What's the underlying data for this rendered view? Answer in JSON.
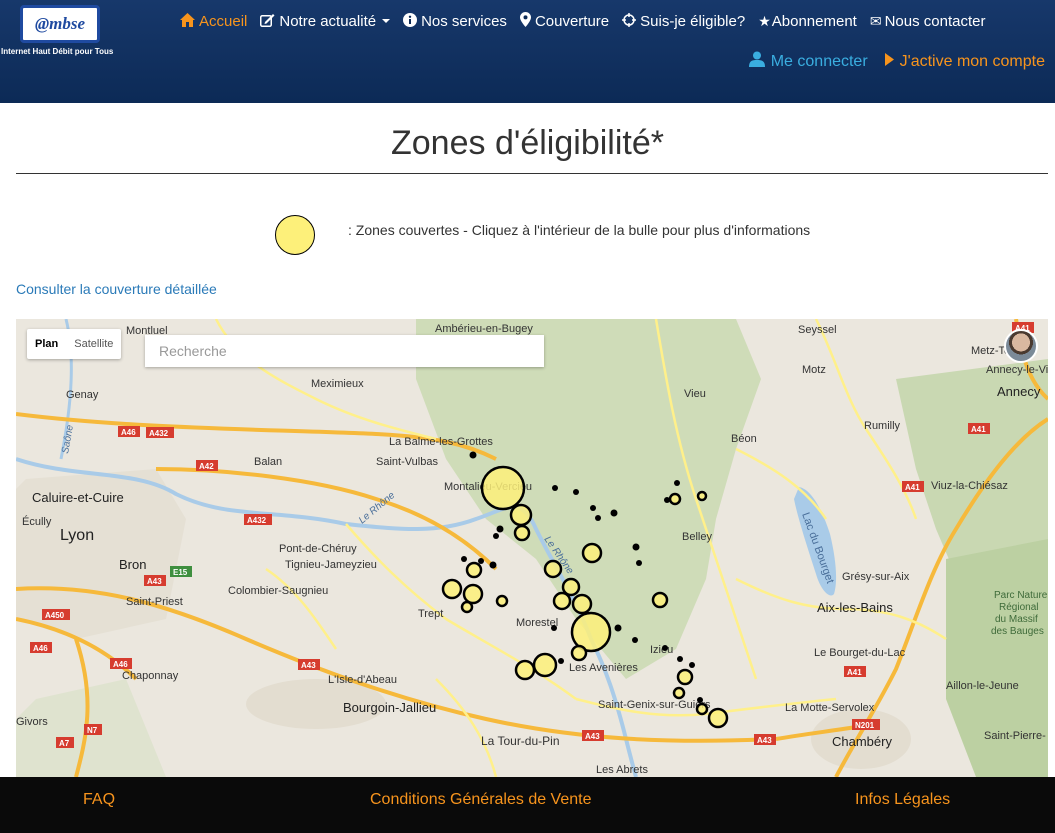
{
  "brand": {
    "logo_text": "@mbse",
    "tagline": "Internet Haut Débit pour Tous"
  },
  "nav": {
    "items": [
      {
        "label": "Accueil",
        "icon": "home-icon",
        "active": true
      },
      {
        "label": "Notre actualité",
        "icon": "edit-icon",
        "dropdown": true
      },
      {
        "label": "Nos services",
        "icon": "info-icon"
      },
      {
        "label": "Couverture",
        "icon": "map-marker-icon"
      },
      {
        "label": "Suis-je éligible?",
        "icon": "crosshair-icon"
      },
      {
        "label": "Abonnement",
        "icon": "star-icon"
      },
      {
        "label": "Nous contacter",
        "icon": "envelope-icon"
      }
    ],
    "account": {
      "login_label": "Me connecter",
      "activate_label": "J'active mon compte"
    }
  },
  "page": {
    "title": "Zones d'éligibilité*",
    "legend_text": ": Zones couvertes - Cliquez à l'intérieur de la bulle pour plus d'informations",
    "detail_link": "Consulter la couverture détaillée"
  },
  "map": {
    "type_plan": "Plan",
    "type_satellite": "Satellite",
    "search_placeholder": "Recherche",
    "zone_color": "#fdf07a",
    "places": [
      "Montluel",
      "Meximieux",
      "Ambérieu-en-Bugey",
      "Genay",
      "Balan",
      "La Balme-les-Grottes",
      "Saint-Vulbas",
      "Caluire-et-Cuire",
      "Écully",
      "Lyon",
      "Bron",
      "Saint-Priest",
      "Pont-de-Chéruy",
      "Tignieu-Jameyzieu",
      "Colombier-Saugnieu",
      "Chaponnay",
      "L'Isle-d'Abeau",
      "Bourgoin-Jallieu",
      "Givors",
      "La Tour-du-Pin",
      "Les Abrets",
      "Montalieu-Vercieu",
      "Trept",
      "Morestel",
      "Les Avenières",
      "Saint-Genix-sur-Guiers",
      "Izieu",
      "Belley",
      "Béon",
      "Vieu",
      "Seyssel",
      "Motz",
      "Rumilly",
      "Metz-Tessy",
      "Annecy-le-Vieux",
      "Annecy",
      "Viuz-la-Chiésaz",
      "Lac du Bourget",
      "Grésy-sur-Aix",
      "Aix-les-Bains",
      "Le Bourget-du-Lac",
      "Aillon-le-Jeune",
      "La Motte-Servolex",
      "Chambéry",
      "Saint-Pierre-",
      "Parc Naturel",
      "Régional",
      "du Massif",
      "des Bauges",
      "Le Rhône",
      "Le Rhône",
      "Saône"
    ],
    "road_labels": [
      "A46",
      "A432",
      "A42",
      "A432",
      "A46",
      "A43",
      "E15",
      "A450",
      "A46",
      "N7",
      "A7",
      "A43",
      "A43",
      "A43",
      "A41",
      "A41",
      "A41",
      "N201",
      "A41"
    ]
  },
  "footer": {
    "faq": "FAQ",
    "cgv": "Conditions Générales de Vente",
    "legal": "Infos Légales"
  }
}
